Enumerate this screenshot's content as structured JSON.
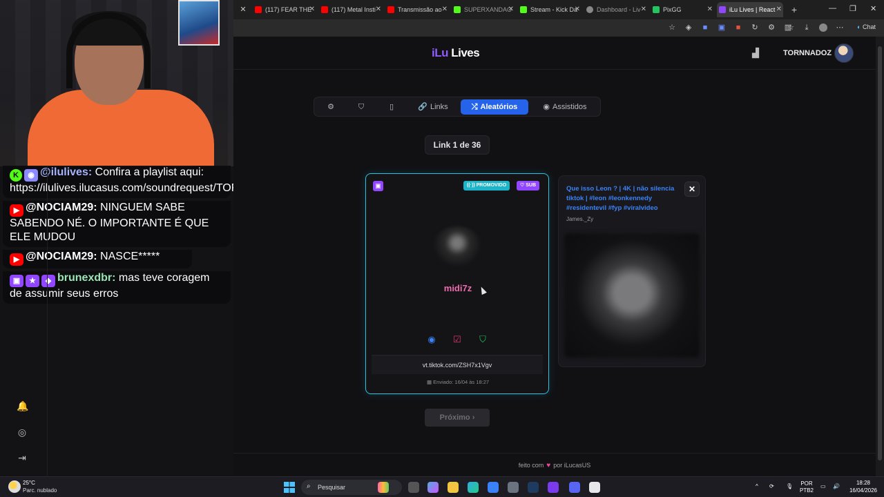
{
  "browser": {
    "tabs": [
      {
        "label": "(117) FEAR THE",
        "color": "#ff0000"
      },
      {
        "label": "(117) Metal Insti",
        "color": "#ff0000"
      },
      {
        "label": "Transmissão ao",
        "color": "#ff0000"
      },
      {
        "label": "SUPERXANDAO",
        "color": "#53fc18"
      },
      {
        "label": "Stream - Kick Da",
        "color": "#53fc18"
      },
      {
        "label": "Dashboard - Liv",
        "color": "#888888"
      },
      {
        "label": "PixGG",
        "color": "#22c55e"
      },
      {
        "label": "iLu Lives | React",
        "color": "#9146ff"
      }
    ],
    "chat_button": "Chat"
  },
  "stream_chat": [
    {
      "badges": [
        "kick",
        "bot"
      ],
      "user": "@ilulives:",
      "user_color": "#a5b4fc",
      "text": " Confira a playlist aqui: https://ilulives.ilucasus.com/soundrequest/TORNNADOZ"
    },
    {
      "badges": [
        "youtube"
      ],
      "user": "@NOCIAM29:",
      "user_color": "#ffffff",
      "text": " NINGUEM SABE SABENDO NÉ. O IMPORTANTE É QUE ELE MUDOU"
    },
    {
      "badges": [
        "youtube"
      ],
      "user": "@NOCIAM29:",
      "user_color": "#ffffff",
      "text": " NASCE*****"
    },
    {
      "badges": [
        "twitch",
        "star",
        "diamond"
      ],
      "user": "brunexdbr:",
      "user_color": "#9ae6b4",
      "text": " mas teve coragem de assumir seus erros"
    }
  ],
  "app": {
    "logo_prefix": "iLu",
    "logo_suffix": "Lives",
    "user_name": "TORNNADOZ",
    "nav": {
      "links": "Links",
      "random": "Aleatórios",
      "watched": "Assistidos"
    },
    "counter": "Link 1 de 36",
    "main_card": {
      "platform_icon": "twitch-icon",
      "badge_promo": "PROMOVIDO",
      "badge_sub": "SUB",
      "username": "midi7z",
      "link": "vt.tiktok.com/ZSH7x1Vgv",
      "sent": "Enviado: 16/04 às 18:27"
    },
    "side_card": {
      "title": "Que isso Leon ? | 4K | não silencia tiktok | #leon #leonkennedy #residentevil #fyp #viralvideo",
      "author": "James._Zy"
    },
    "next_button": "Próximo ›",
    "footer_before": "feito com",
    "footer_after": "por iLucasUS"
  },
  "taskbar": {
    "temperature": "25°C",
    "weather": "Parc. nublado",
    "search": "Pesquisar",
    "lang_top": "POR",
    "lang_bottom": "PTB2",
    "time": "18:28",
    "date": "16/04/2026"
  },
  "colors": {
    "accent": "#2563eb",
    "brand_purple": "#8e5cff",
    "card_border": "#27c6e6",
    "username_pink": "#f06bb0"
  }
}
